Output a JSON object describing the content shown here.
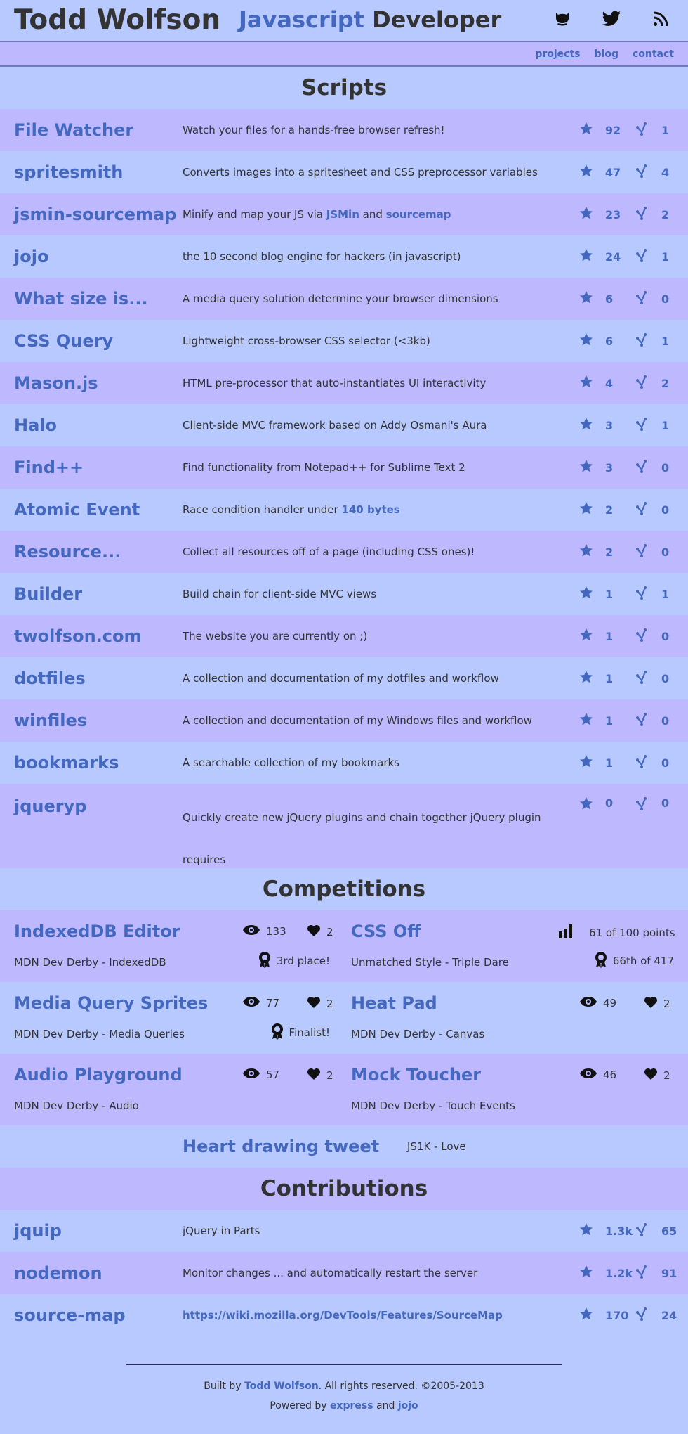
{
  "header": {
    "name": "Todd Wolfson",
    "tagline_js": "Javascript",
    "tagline_rest": "Developer",
    "icons": [
      "github-icon",
      "twitter-icon",
      "rss-icon"
    ]
  },
  "nav": {
    "projects": "projects",
    "blog": "blog",
    "contact": "contact"
  },
  "sections": {
    "scripts": "Scripts",
    "competitions": "Competitions",
    "contributions": "Contributions"
  },
  "scripts": [
    {
      "name": "File Watcher",
      "desc": "Watch your files for a hands-free browser refresh!",
      "stars": "92",
      "forks": "1"
    },
    {
      "name": "spritesmith",
      "desc": "Converts images into a spritesheet and CSS preprocessor variables",
      "stars": "47",
      "forks": "4"
    },
    {
      "name": "jsmin-sourcemap",
      "desc_pre": "Minify and map your JS via ",
      "desc_link1": "JSMin",
      "desc_mid": " and ",
      "desc_link2": "sourcemap",
      "stars": "23",
      "forks": "2"
    },
    {
      "name": "jojo",
      "desc": "the 10 second blog engine for hackers (in javascript)",
      "stars": "24",
      "forks": "1"
    },
    {
      "name": "What size is...",
      "desc": "A media query solution determine your browser dimensions",
      "stars": "6",
      "forks": "0"
    },
    {
      "name": "CSS Query",
      "desc": "Lightweight cross-browser CSS selector (<3kb)",
      "stars": "6",
      "forks": "1"
    },
    {
      "name": "Mason.js",
      "desc": "HTML pre-processor that auto-instantiates UI interactivity",
      "stars": "4",
      "forks": "2"
    },
    {
      "name": "Halo",
      "desc": "Client-side MVC framework based on Addy Osmani's Aura",
      "stars": "3",
      "forks": "1"
    },
    {
      "name": "Find++",
      "desc": "Find functionality from Notepad++ for Sublime Text 2",
      "stars": "3",
      "forks": "0"
    },
    {
      "name": "Atomic Event",
      "desc_pre": "Race condition handler under ",
      "desc_link1": "140 bytes",
      "stars": "2",
      "forks": "0"
    },
    {
      "name": "Resource...",
      "desc": "Collect all resources off of a page (including CSS ones)!",
      "stars": "2",
      "forks": "0"
    },
    {
      "name": "Builder",
      "desc": "Build chain for client-side MVC views",
      "stars": "1",
      "forks": "1"
    },
    {
      "name": "twolfson.com",
      "desc": "The website you are currently on ;)",
      "stars": "1",
      "forks": "0"
    },
    {
      "name": "dotfiles",
      "desc": "A collection and documentation of my dotfiles and workflow",
      "stars": "1",
      "forks": "0"
    },
    {
      "name": "winfiles",
      "desc": "A collection and documentation of my Windows files and workflow",
      "stars": "1",
      "forks": "0"
    },
    {
      "name": "bookmarks",
      "desc": "A searchable collection of my bookmarks",
      "stars": "1",
      "forks": "0"
    },
    {
      "name": "jqueryp",
      "desc": "Quickly create new jQuery plugins and chain together jQuery plugin requires",
      "stars": "0",
      "forks": "0"
    }
  ],
  "competitions": {
    "indexeddb": {
      "name": "IndexedDB Editor",
      "views": "133",
      "likes": "2",
      "event": "MDN Dev Derby - IndexedDB",
      "award": "3rd place!"
    },
    "cssoff": {
      "name": "CSS Off",
      "points": "61 of 100 points",
      "event": "Unmatched Style - Triple Dare",
      "award": "66th of 417"
    },
    "mqsprites": {
      "name": "Media Query Sprites",
      "views": "77",
      "likes": "2",
      "event": "MDN Dev Derby - Media Queries",
      "award": "Finalist!"
    },
    "heatpad": {
      "name": "Heat Pad",
      "views": "49",
      "likes": "2",
      "event": "MDN Dev Derby - Canvas"
    },
    "audio": {
      "name": "Audio Playground",
      "views": "57",
      "likes": "2",
      "event": "MDN Dev Derby - Audio"
    },
    "mock": {
      "name": "Mock Toucher",
      "views": "46",
      "likes": "2",
      "event": "MDN Dev Derby - Touch Events"
    },
    "heart": {
      "name": "Heart drawing tweet",
      "event": "JS1K - Love"
    }
  },
  "contributions": [
    {
      "name": "jquip",
      "desc": "jQuery in Parts",
      "stars": "1.3k",
      "forks": "65"
    },
    {
      "name": "nodemon",
      "desc": "Monitor changes ... and automatically restart the server",
      "stars": "1.2k",
      "forks": "91"
    },
    {
      "name": "source-map",
      "desc_link1": "https://wiki.mozilla.org/DevTools/Features/SourceMap",
      "stars": "170",
      "forks": "24"
    }
  ],
  "footer": {
    "built_pre": "Built by ",
    "built_link": "Todd Wolfson",
    "built_post": ". All rights reserved. ©2005-2013",
    "powered_pre": "Powered by ",
    "powered_link1": "express",
    "powered_mid": " and ",
    "powered_link2": "jojo"
  },
  "colors": {
    "accent": "#4468c0",
    "row_a": "#bdb8ff",
    "row_b": "#b8c9ff",
    "text": "#333333"
  }
}
